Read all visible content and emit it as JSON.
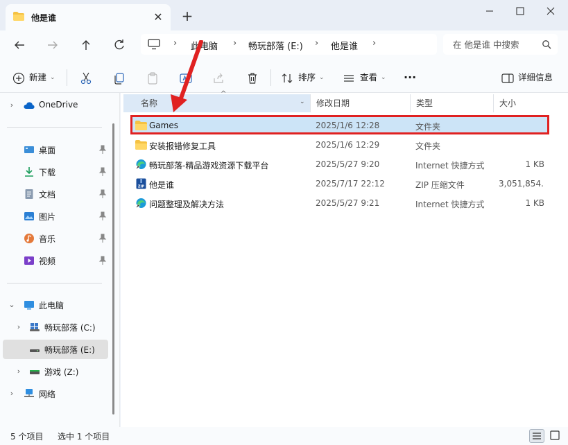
{
  "window": {
    "tab_title": "他是谁",
    "new_tab_symbol": "+"
  },
  "breadcrumbs": [
    "此电脑",
    "畅玩部落 (E:)",
    "他是谁"
  ],
  "search": {
    "placeholder": "在 他是谁 中搜索"
  },
  "toolbar": {
    "new_label": "新建",
    "sort_label": "排序",
    "view_label": "查看",
    "more_label": "···",
    "details_label": "详细信息"
  },
  "sidebar": {
    "onedrive": "OneDrive",
    "quick_access": [
      {
        "label": "桌面"
      },
      {
        "label": "下载"
      },
      {
        "label": "文档"
      },
      {
        "label": "图片"
      },
      {
        "label": "音乐"
      },
      {
        "label": "视频"
      }
    ],
    "this_pc": "此电脑",
    "drives": [
      {
        "label": "畅玩部落 (C:)"
      },
      {
        "label": "畅玩部落 (E:)"
      },
      {
        "label": "游戏 (Z:)"
      }
    ],
    "network": "网络"
  },
  "columns": {
    "name": "名称",
    "date": "修改日期",
    "type": "类型",
    "size": "大小"
  },
  "files": [
    {
      "name": "Games",
      "date": "2025/1/6 12:28",
      "type": "文件夹",
      "size": "",
      "icon": "folder-icon"
    },
    {
      "name": "安装报错修复工具",
      "date": "2025/1/6 12:29",
      "type": "文件夹",
      "size": "",
      "icon": "folder-icon"
    },
    {
      "name": "畅玩部落-精品游戏资源下载平台",
      "date": "2025/5/27 9:20",
      "type": "Internet 快捷方式",
      "size": "1 KB",
      "icon": "edge-shortcut-icon"
    },
    {
      "name": "他是谁",
      "date": "2025/7/17 22:12",
      "type": "ZIP 压缩文件",
      "size": "3,051,854...",
      "icon": "zip-icon"
    },
    {
      "name": "问题整理及解决方法",
      "date": "2025/5/27 9:21",
      "type": "Internet 快捷方式",
      "size": "1 KB",
      "icon": "edge-shortcut-icon"
    }
  ],
  "status": {
    "count": "5 个项目",
    "selected": "选中 1 个项目"
  },
  "colors": {
    "accent": "#0067c0",
    "selection": "#cce4f7",
    "highlight_box": "#e02121",
    "folder": "#f5c243"
  }
}
